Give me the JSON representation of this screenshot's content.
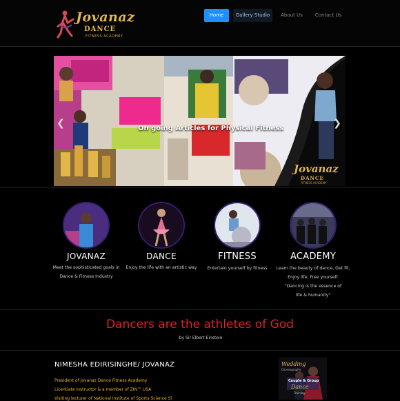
{
  "brand": {
    "name": "Jovanaz",
    "line2": "DANCE",
    "line3": "FITNESS ACADEMY"
  },
  "nav": [
    {
      "label": "Home",
      "active": true
    },
    {
      "label": "Gallery Studio",
      "active": false
    },
    {
      "label": "About Us",
      "active": false
    },
    {
      "label": "Contact Us",
      "active": false
    }
  ],
  "slider": {
    "caption": "On going Articles for Physical Fitness",
    "prev_icon": "chevron-left-icon",
    "next_icon": "chevron-right-icon",
    "logo_name": "Jovanaz",
    "logo_line2": "DANCE",
    "logo_line3": "FITNESS ACADEMY"
  },
  "features": [
    {
      "title": "JOVANAZ",
      "desc": [
        "Meet the sophisticated goals in",
        "Dance & Fitness Industry"
      ],
      "image_color": "#6a3fa0"
    },
    {
      "title": "DANCE",
      "desc": [
        "Enjoy the life with an artistic way"
      ],
      "image_color": "#a04a6a"
    },
    {
      "title": "FITNESS",
      "desc": [
        "Entertain yourself by fitness"
      ],
      "image_color": "#7fa0c8"
    },
    {
      "title": "ACADEMY",
      "desc": [
        "Learn the beauty of dance, Get fit,",
        "Enjoy life, Free yourself.",
        "\"Dancing is the essence of",
        "life & humanity\""
      ],
      "image_color": "#3a3a5a"
    }
  ],
  "quote": {
    "text": "Dancers are the athletes of God",
    "by": "-by Sir Elbert Einstein"
  },
  "bio": {
    "name": "NIMESHA EDIRISINGHE/ JOVANAZ",
    "lines": [
      "President of Jovanaz Dance Fitness Academy",
      "Licentiate Instructor & a member of ZIN™ USA",
      "Visiting lecturer of National Institute of Sports Science Sl"
    ]
  },
  "promo": {
    "title": "Wedding",
    "sub": "Choreography",
    "line1": "Couple & Group",
    "line2": "Dance",
    "line3": "Training"
  },
  "colors": {
    "accent": "#1e90ff",
    "quote": "#d9242b",
    "gold": "#e3b64a",
    "bio_text": "#f0b429"
  }
}
